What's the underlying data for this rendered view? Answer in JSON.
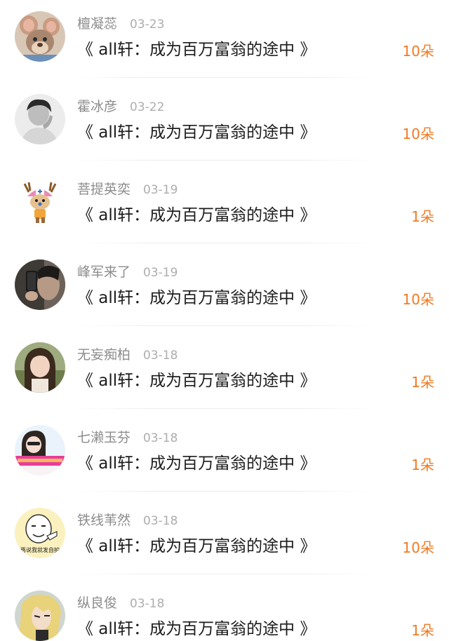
{
  "comments": [
    {
      "name": "檀凝蕊",
      "date": "03-23",
      "title": "《 all轩：成为百万富翁的途中 》",
      "count": "10朵",
      "avatar": "cartoon-mouse"
    },
    {
      "name": "霍冰彦",
      "date": "03-22",
      "title": "《 all轩：成为百万富翁的途中 》",
      "count": "10朵",
      "avatar": "grayscale-person"
    },
    {
      "name": "菩提英奕",
      "date": "03-19",
      "title": "《 all轩：成为百万富翁的途中 》",
      "count": "1朵",
      "avatar": "cartoon-reindeer"
    },
    {
      "name": "峰军来了",
      "date": "03-19",
      "title": "《 all轩：成为百万富翁的途中 》",
      "count": "10朵",
      "avatar": "phone-selfie"
    },
    {
      "name": "无妄痴柏",
      "date": "03-18",
      "title": "《 all轩：成为百万富翁的途中 》",
      "count": "1朵",
      "avatar": "girl-photo"
    },
    {
      "name": "七濑玉芬",
      "date": "03-18",
      "title": "《 all轩：成为百万富翁的途中 》",
      "count": "1朵",
      "avatar": "girl-banner"
    },
    {
      "name": "铁线苇然",
      "date": "03-18",
      "title": "《 all轩：成为百万富翁的途中 》",
      "count": "10朵",
      "avatar": "meme-face",
      "avatar_caption": "\"再说我就发自拍\""
    },
    {
      "name": "纵良俊",
      "date": "03-18",
      "title": "《 all轩：成为百万富翁的途中 》",
      "count": "1朵",
      "avatar": "anime-character"
    }
  ]
}
